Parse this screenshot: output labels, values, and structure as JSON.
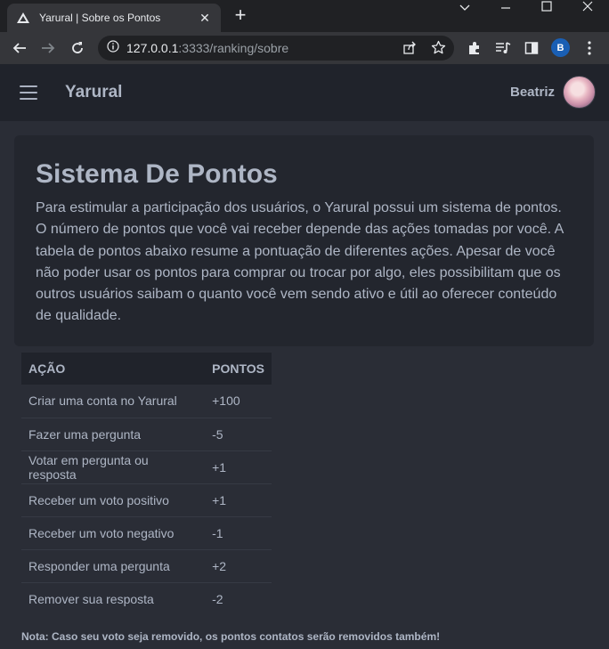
{
  "browser": {
    "tab_title": "Yarural | Sobre os Pontos",
    "url_host": "127.0.0.1",
    "url_rest": ":3333/ranking/sobre",
    "profile_initial": "B"
  },
  "app": {
    "brand": "Yarural",
    "username": "Beatriz"
  },
  "main": {
    "title": "Sistema De Pontos",
    "description": "Para estimular a participação dos usuários, o Yarural possui um sistema de pontos. O número de pontos que você vai receber depende das ações tomadas por você. A tabela de pontos abaixo resume a pontuação de diferentes ações. Apesar de você não poder usar os pontos para comprar ou trocar por algo, eles possibilitam que os outros usuários saibam o quanto você vem sendo ativo e útil ao oferecer conteúdo de qualidade.",
    "table": {
      "headers": [
        "AÇÃO",
        "PONTOS"
      ],
      "rows": [
        {
          "action": "Criar uma conta no Yarural",
          "points": "+100"
        },
        {
          "action": "Fazer uma pergunta",
          "points": "-5"
        },
        {
          "action": "Votar em pergunta ou resposta",
          "points": "+1"
        },
        {
          "action": "Receber um voto positivo",
          "points": "+1"
        },
        {
          "action": "Receber um voto negativo",
          "points": "-1"
        },
        {
          "action": "Responder uma pergunta",
          "points": "+2"
        },
        {
          "action": "Remover sua resposta",
          "points": "-2"
        }
      ]
    },
    "note": "Nota: Caso seu voto seja removido, os pontos contatos serão removidos também!"
  },
  "colors": {
    "background": "#2a2d36",
    "card": "#23262e",
    "appbar": "#20232b",
    "text": "#aeb6c5"
  },
  "icons": [
    "yarural-favicon-icon",
    "close-icon",
    "plus-icon",
    "minimize-icon",
    "maximize-icon",
    "window-close-icon",
    "back-icon",
    "forward-icon",
    "reload-icon",
    "info-icon",
    "share-icon",
    "star-icon",
    "extensions-icon",
    "media-icon",
    "sidepanel-icon",
    "menu-icon",
    "hamburger-icon"
  ]
}
